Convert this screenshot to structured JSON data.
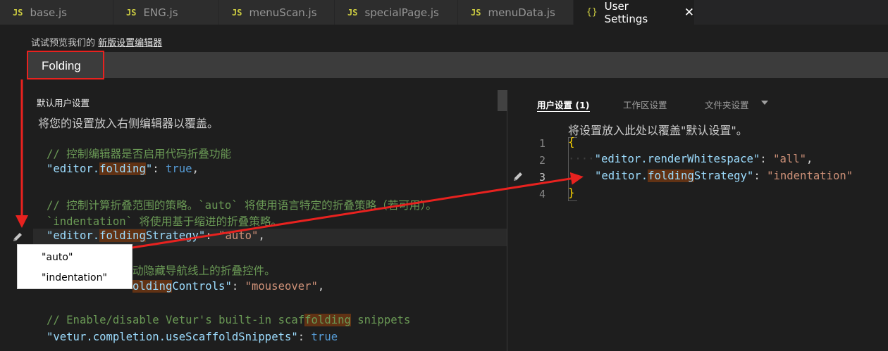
{
  "tabs": [
    {
      "icon": "JS",
      "label": "base.js"
    },
    {
      "icon": "JS",
      "label": "ENG.js"
    },
    {
      "icon": "JS",
      "label": "menuScan.js"
    },
    {
      "icon": "JS",
      "label": "specialPage.js"
    },
    {
      "icon": "JS",
      "label": "menuData.js"
    },
    {
      "icon": "{}",
      "label": "User Settings",
      "close": "✕"
    }
  ],
  "preview": {
    "prefix": "试试预览我们的 ",
    "link": "新版设置编辑器"
  },
  "search": {
    "value": "Folding"
  },
  "left": {
    "title": "默认用户设置",
    "description": "将您的设置放入右侧编辑器以覆盖。",
    "line1_comment": "// 控制编辑器是否启用代码折叠功能",
    "line1_key_a": "\"editor.",
    "line1_key_hl": "folding",
    "line1_key_b": "\"",
    "line1_sep": ": ",
    "line1_val": "true",
    "line1_end": ",",
    "line2_comment_a": "// 控制计算折叠范围的策略。`auto` 将使用语言特定的折叠策略（若可用）。",
    "line2_comment_b": "`indentation` 将使用基于缩进的折叠策略。",
    "line2_key_a": "\"editor.",
    "line2_key_hl": "folding",
    "line2_key_b": "Strategy\"",
    "line2_sep": ": ",
    "line2_val": "\"auto\"",
    "line2_end": ",",
    "line3_comment": "动隐藏导航线上的折叠控件。",
    "line3_key_hl": "olding",
    "line3_key_b": "Controls\"",
    "line3_sep": ": ",
    "line3_val": "\"mouseover\"",
    "line3_end": ",",
    "line4_comment_a": "// Enable/disable Vetur's built-in scaf",
    "line4_comment_hl": "folding",
    "line4_comment_b": " snippets",
    "line4_key": "\"vetur.completion.useScaffoldSnippets\"",
    "line4_sep": ": ",
    "line4_val": "true"
  },
  "dropdown": {
    "options": [
      "\"auto\"",
      "\"indentation\""
    ]
  },
  "right": {
    "tabs": [
      "用户设置 (1)",
      "工作区设置",
      "文件夹设置"
    ],
    "description": "将设置放入此处以覆盖\"默认设置\"。",
    "line_numbers": [
      "1",
      "2",
      "3",
      "4"
    ],
    "open_brace": "{",
    "close_brace": "}",
    "r2_dots": "····",
    "r2_key": "\"editor.renderWhitespace\"",
    "r2_sep": ": ",
    "r2_val": "\"all\"",
    "r2_end": ",",
    "r3_key_a": "\"editor.",
    "r3_key_hl": "folding",
    "r3_key_b": "Strategy\"",
    "r3_sep": ": ",
    "r3_val": "\"indentation\""
  },
  "colors": {
    "annotation_red": "#e8221f",
    "match_highlight": "#613214"
  }
}
